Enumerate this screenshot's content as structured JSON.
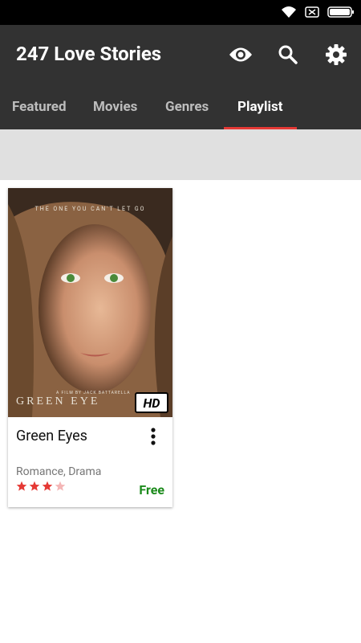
{
  "app": {
    "title": "247 Love Stories"
  },
  "actions": {
    "visibility_icon": "eye-icon",
    "search_icon": "search-icon",
    "settings_icon": "gear-icon"
  },
  "tabs": [
    {
      "label": "Featured",
      "active": false
    },
    {
      "label": "Movies",
      "active": false
    },
    {
      "label": "Genres",
      "active": false
    },
    {
      "label": "Playlist",
      "active": true
    }
  ],
  "movie": {
    "title": "Green Eyes",
    "genres": "Romance, Drama",
    "price": "Free",
    "rating": 3,
    "rating_max": 4,
    "poster": {
      "tagline": "THE ONE YOU CAN'T LET GO",
      "title_text": "GREEN EYE",
      "director": "A FILM BY JACK BATTARELLA",
      "badge": "HD"
    }
  },
  "colors": {
    "appbar": "#323232",
    "tab_indicator": "#e53935",
    "price": "#1b8a1b",
    "star_filled": "#e53935",
    "star_empty": "#f4b6b6"
  }
}
